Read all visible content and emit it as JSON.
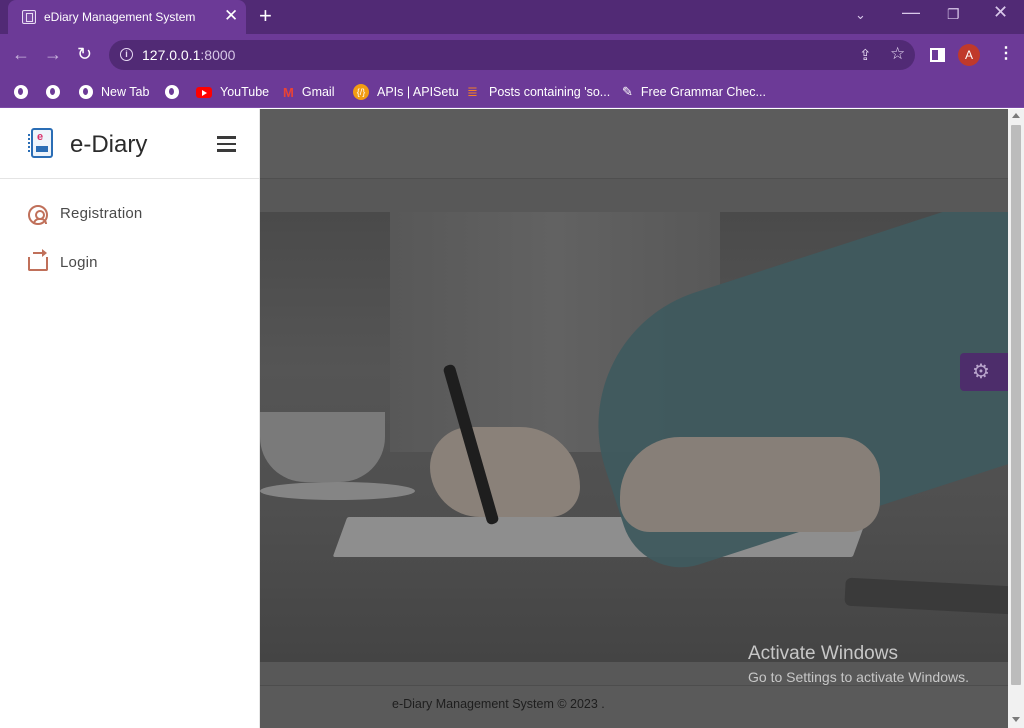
{
  "browser": {
    "tab_title": "eDiary Management System",
    "tab_close": "✕",
    "new_tab": "+",
    "url_host": "127.0.0.1",
    "url_port": ":8000",
    "avatar_letter": "A",
    "window_controls": {
      "menu": "⌄",
      "minimize": "—",
      "maximize": "❐",
      "close": "✕"
    }
  },
  "bookmarks": [
    {
      "label": "",
      "icon": "globe-icon"
    },
    {
      "label": "",
      "icon": "globe-icon"
    },
    {
      "label": "New Tab",
      "icon": "globe-icon"
    },
    {
      "label": "",
      "icon": "globe-icon"
    },
    {
      "label": "YouTube",
      "icon": "youtube-icon"
    },
    {
      "label": "Gmail",
      "icon": "gmail-icon"
    },
    {
      "label": "APIs | APISetu",
      "icon": "apisetu-icon"
    },
    {
      "label": "Posts containing 'so...",
      "icon": "stackoverflow-icon"
    },
    {
      "label": "Free Grammar Chec...",
      "icon": "pen-icon"
    }
  ],
  "sidebar": {
    "brand": "e-Diary",
    "logo_letter": "e",
    "items": [
      {
        "label": "Registration",
        "icon": "user-circle-icon"
      },
      {
        "label": "Login",
        "icon": "login-icon"
      }
    ]
  },
  "main": {
    "footer": "e-Diary Management System © 2023 .",
    "settings_icon": "⚙"
  },
  "watermark": {
    "title": "Activate Windows",
    "subtitle": "Go to Settings to activate Windows."
  },
  "colors": {
    "browser_frame": "#6c3a97",
    "browser_tabstrip": "#512a75",
    "sidebar_icon_accent": "#c0705a",
    "settings_tab": "#4d2d6b",
    "overlay_gray": "#585858"
  }
}
